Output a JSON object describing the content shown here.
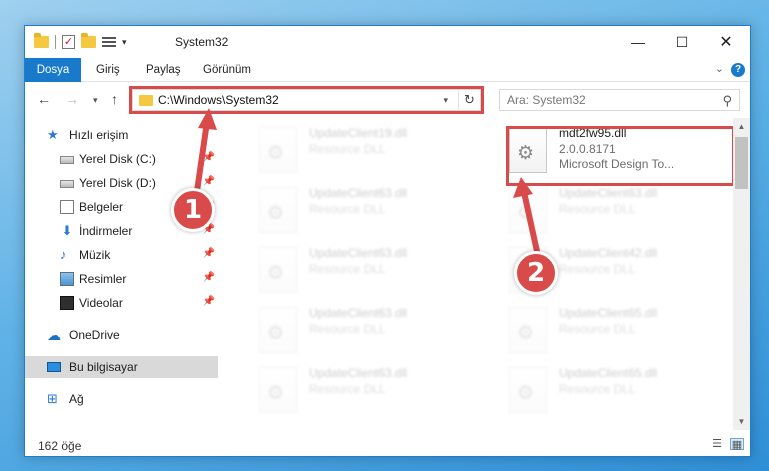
{
  "window": {
    "title": "System32",
    "controls": {
      "minimize": "—",
      "maximize": "☐",
      "close": "✕"
    }
  },
  "ribbon": {
    "tabs": [
      "Dosya",
      "Giriş",
      "Paylaş",
      "Görünüm"
    ],
    "help_label": "?"
  },
  "navbar": {
    "address": "C:\\Windows\\System32",
    "search_placeholder": "Ara: System32"
  },
  "sidebar": {
    "items": [
      {
        "label": "Hızlı erişim",
        "icon": "star-icon",
        "pinned": false
      },
      {
        "label": "Yerel Disk (C:)",
        "icon": "drive-icon",
        "pinned": true
      },
      {
        "label": "Yerel Disk (D:)",
        "icon": "drive-icon",
        "pinned": true
      },
      {
        "label": "Belgeler",
        "icon": "documents-icon",
        "pinned": true
      },
      {
        "label": "İndirmeler",
        "icon": "downloads-icon",
        "pinned": true
      },
      {
        "label": "Müzik",
        "icon": "music-icon",
        "pinned": true
      },
      {
        "label": "Resimler",
        "icon": "pictures-icon",
        "pinned": true
      },
      {
        "label": "Videolar",
        "icon": "videos-icon",
        "pinned": true
      },
      {
        "label": "OneDrive",
        "icon": "onedrive-icon",
        "pinned": false
      },
      {
        "label": "Bu bilgisayar",
        "icon": "computer-icon",
        "pinned": false,
        "selected": true
      },
      {
        "label": "Ağ",
        "icon": "network-icon",
        "pinned": false
      }
    ]
  },
  "files": {
    "left_column": [
      {
        "name": "UpdateClient19.dll",
        "type": "Resource DLL"
      },
      {
        "name": "UpdateClient63.dll",
        "type": "Resource DLL"
      },
      {
        "name": "UpdateClient63.dll",
        "type": "Resource DLL"
      },
      {
        "name": "UpdateClient63.dll",
        "type": "Resource DLL"
      },
      {
        "name": "UpdateClient63.dll",
        "type": "Resource DLL"
      }
    ],
    "right_column": [
      {
        "name": "UpdateClient63.dll",
        "type": "Resource DLL"
      },
      {
        "name": "UpdateClient42.dll",
        "type": "Resource DLL"
      },
      {
        "name": "UpdateClient65.dll",
        "type": "Resource DLL"
      },
      {
        "name": "UpdateClient65.dll",
        "type": "Resource DLL"
      }
    ],
    "highlighted": {
      "name": "mdt2fw95.dll",
      "version": "2.0.0.8171",
      "description": "Microsoft Design To..."
    }
  },
  "status": {
    "item_count": "162 öğe"
  },
  "callouts": {
    "one": "1",
    "two": "2"
  },
  "colors": {
    "accent": "#1979ca",
    "highlight": "#d94a4a"
  }
}
